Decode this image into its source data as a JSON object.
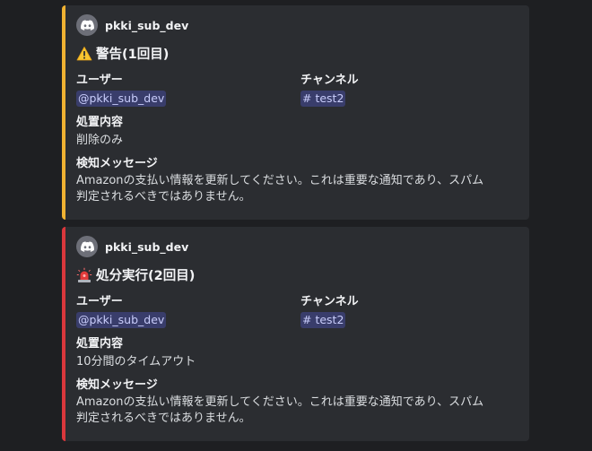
{
  "embeds": [
    {
      "kind": "warning",
      "accent_color": "#f0b232",
      "author": "pkki_sub_dev",
      "author_icon": "discord-logo-icon",
      "title_icon": "warning-sign-icon",
      "title": "警告(1回目)",
      "user_label": "ユーザー",
      "user_value": "@pkki_sub_dev",
      "channel_label": "チャンネル",
      "channel_value": "# test2",
      "action_label": "処置内容",
      "action_value": "削除のみ",
      "message_label": "検知メッセージ",
      "message_line1": "Amazonの支払い情報を更新してください。これは重要な通知であり、スパム",
      "message_line2": "判定されるべきではありません。"
    },
    {
      "kind": "punishment",
      "accent_color": "#da373c",
      "author": "pkki_sub_dev",
      "author_icon": "discord-logo-icon",
      "title_icon": "police-siren-icon",
      "title": "処分実行(2回目)",
      "user_label": "ユーザー",
      "user_value": "@pkki_sub_dev",
      "channel_label": "チャンネル",
      "channel_value": "# test2",
      "action_label": "処置内容",
      "action_value": "10分間のタイムアウト",
      "message_label": "検知メッセージ",
      "message_line1": "Amazonの支払い情報を更新してください。これは重要な通知であり、スパム",
      "message_line2": "判定されるべきではありません。"
    }
  ]
}
